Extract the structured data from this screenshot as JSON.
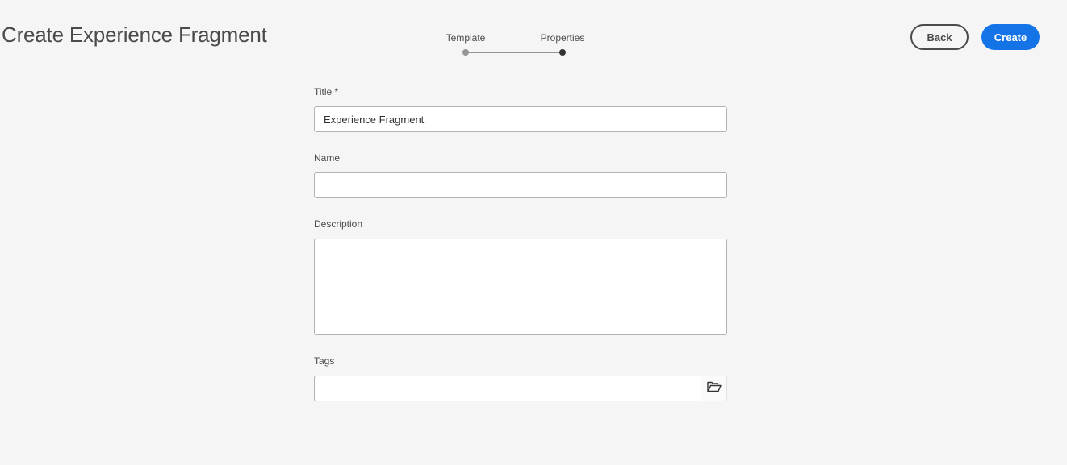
{
  "header": {
    "title": "Create Experience Fragment",
    "steps": [
      {
        "label": "Template",
        "state": "completed"
      },
      {
        "label": "Properties",
        "state": "current"
      }
    ],
    "back_label": "Back",
    "create_label": "Create",
    "accent_color": "#1473e6"
  },
  "form": {
    "title": {
      "label": "Title *",
      "value": "Experience Fragment"
    },
    "name": {
      "label": "Name",
      "value": ""
    },
    "description": {
      "label": "Description",
      "value": ""
    },
    "tags": {
      "label": "Tags",
      "value": "",
      "browse_icon": "folder-open-icon"
    }
  }
}
